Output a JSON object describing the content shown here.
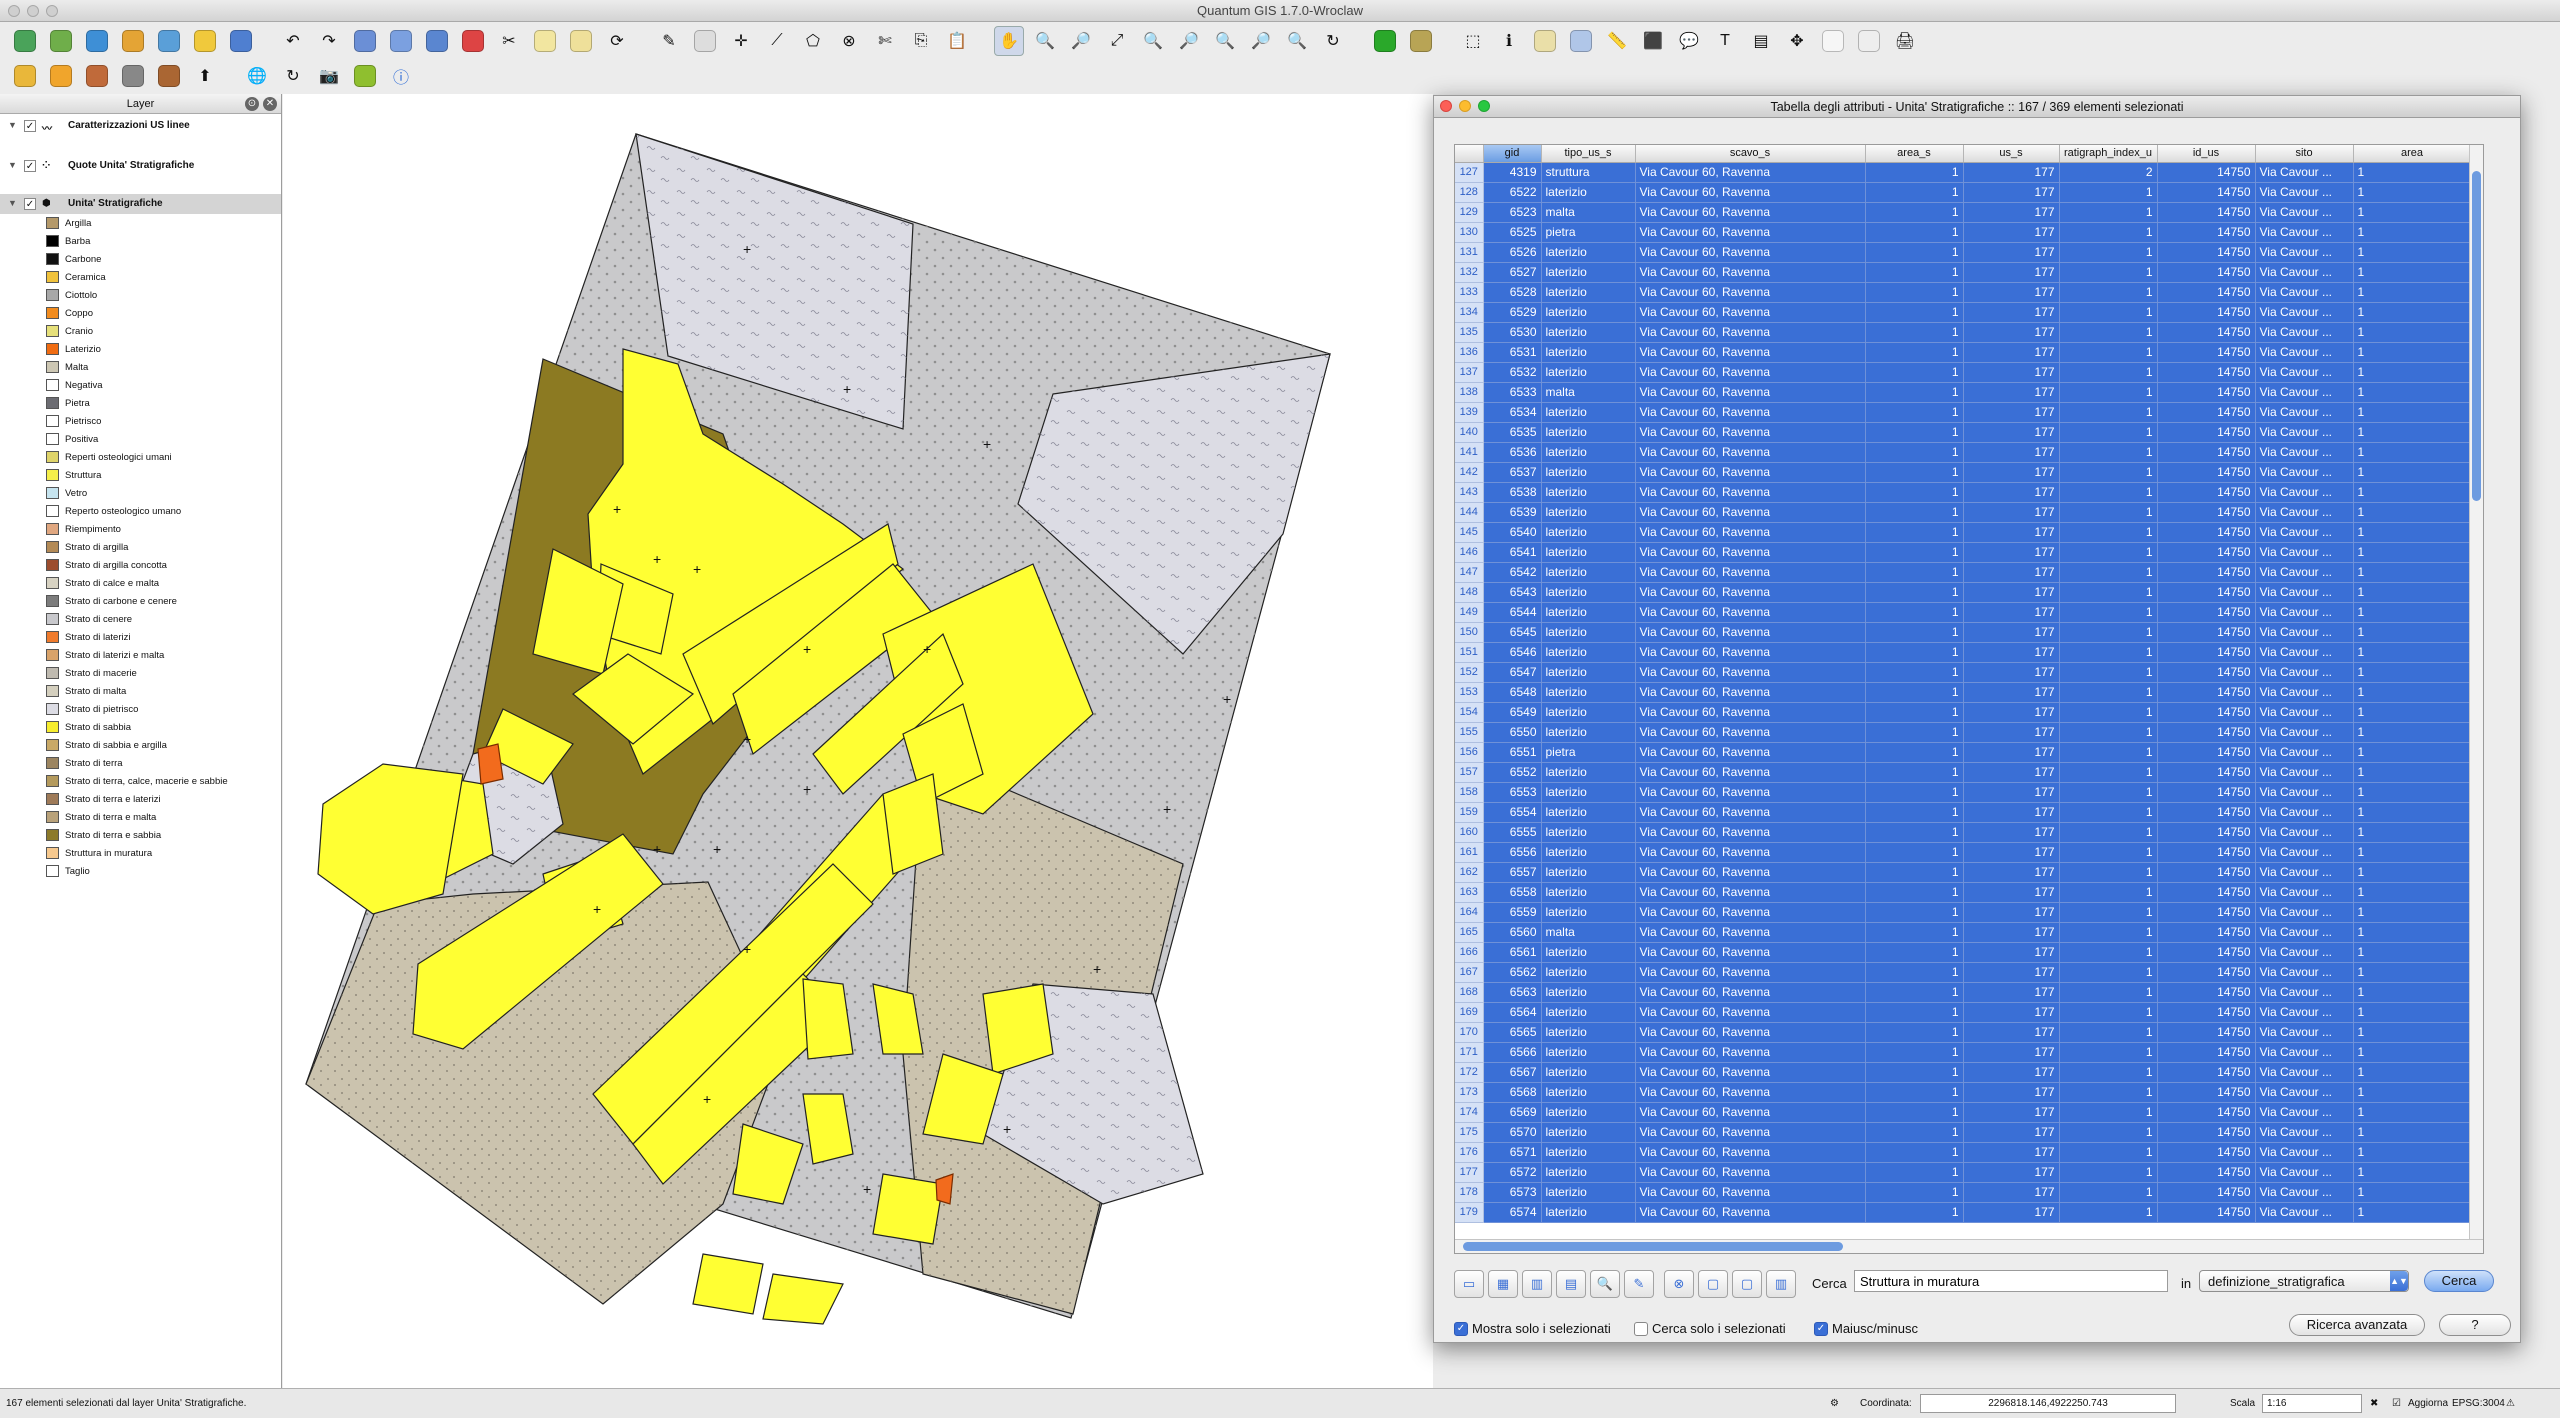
{
  "app": {
    "title": "Quantum GIS 1.7.0-Wroclaw"
  },
  "layer_panel": {
    "title": "Layer",
    "layers": [
      {
        "name": "Caratterizzazioni US linee",
        "checked": true
      },
      {
        "name": "Quote Unita' Stratigrafiche",
        "checked": true
      },
      {
        "name": "Unita' Stratigrafiche",
        "checked": true
      }
    ],
    "legend": [
      {
        "label": "Argilla",
        "color": "#b4996a"
      },
      {
        "label": "Barba",
        "color": "#000000"
      },
      {
        "label": "Carbone",
        "color": "#111111"
      },
      {
        "label": "Ceramica",
        "color": "#f0c23c"
      },
      {
        "label": "Ciottolo",
        "color": "#a8a8a8"
      },
      {
        "label": "Coppo",
        "color": "#f28c1e"
      },
      {
        "label": "Cranio",
        "color": "#e6e07a"
      },
      {
        "label": "Laterizio",
        "color": "#f06c12"
      },
      {
        "label": "Malta",
        "color": "#cdc7b3"
      },
      {
        "label": "Negativa",
        "color": "#ffffff"
      },
      {
        "label": "Pietra",
        "color": "#6c6c72"
      },
      {
        "label": "Pietrisco",
        "color": "#ffffff"
      },
      {
        "label": "Positiva",
        "color": "#ffffff"
      },
      {
        "label": "Reperti osteologici umani",
        "color": "#dfd46a"
      },
      {
        "label": "Struttura",
        "color": "#f5ef4a"
      },
      {
        "label": "Vetro",
        "color": "#c6e4ef"
      },
      {
        "label": "Reperto osteologico umano",
        "color": "#ffffff"
      },
      {
        "label": "Riempimento",
        "color": "#e0a780"
      },
      {
        "label": "Strato di argilla",
        "color": "#b38a56"
      },
      {
        "label": "Strato di argilla concotta",
        "color": "#9c4d2e"
      },
      {
        "label": "Strato di calce e malta",
        "color": "#d7d2c2"
      },
      {
        "label": "Strato di carbone e cenere",
        "color": "#7c7c7c"
      },
      {
        "label": "Strato di cenere",
        "color": "#c8c8cc"
      },
      {
        "label": "Strato di laterizi",
        "color": "#ef7b2d"
      },
      {
        "label": "Strato di laterizi e malta",
        "color": "#d9a36a"
      },
      {
        "label": "Strato di macerie",
        "color": "#bfbab0"
      },
      {
        "label": "Strato di malta",
        "color": "#d4cfbe"
      },
      {
        "label": "Strato di pietrisco",
        "color": "#dcdce4"
      },
      {
        "label": "Strato di sabbia",
        "color": "#f6ed2f"
      },
      {
        "label": "Strato di sabbia e argilla",
        "color": "#c9a967"
      },
      {
        "label": "Strato di terra",
        "color": "#9c8560"
      },
      {
        "label": "Strato di terra, calce, macerie e sabbie",
        "color": "#b49a5d"
      },
      {
        "label": "Strato di terra e laterizi",
        "color": "#9e7a58"
      },
      {
        "label": "Strato di terra e malta",
        "color": "#b9a27a"
      },
      {
        "label": "Strato di terra e sabbia",
        "color": "#8c7a2a"
      },
      {
        "label": "Struttura in muratura",
        "color": "#f7c98e"
      },
      {
        "label": "Taglio",
        "color": "#ffffff"
      }
    ]
  },
  "map": {
    "colors": {
      "frame": "#dcdce4",
      "gravel": "#c9c9cb",
      "soil": "#cbc3ae",
      "olive": "#8c7a22",
      "yellow": "#ffff33",
      "orange": "#f26b1d",
      "white": "#ffffff"
    }
  },
  "attr_window": {
    "title": "Tabella degli attributi - Unita' Stratigrafiche :: 167 / 369 elementi selezionati",
    "columns": [
      "gid",
      "tipo_us_s",
      "scavo_s",
      "area_s",
      "us_s",
      "ratigraph_index_u",
      "id_us",
      "sito",
      "area"
    ],
    "row_numbers": [
      127,
      128,
      129,
      130,
      131,
      132,
      133,
      134,
      135,
      136,
      137,
      138,
      139,
      140,
      141,
      142,
      143,
      144,
      145,
      146,
      147,
      148,
      149,
      150,
      151,
      152,
      153,
      154,
      155,
      156,
      157,
      158,
      159,
      160,
      161,
      162,
      163,
      164,
      165,
      166,
      167,
      168,
      169,
      170,
      171,
      172,
      173,
      174,
      175,
      176,
      177,
      178,
      179
    ],
    "gid": [
      4319,
      6522,
      6523,
      6525,
      6526,
      6527,
      6528,
      6529,
      6530,
      6531,
      6532,
      6533,
      6534,
      6535,
      6536,
      6537,
      6538,
      6539,
      6540,
      6541,
      6542,
      6543,
      6544,
      6545,
      6546,
      6547,
      6548,
      6549,
      6550,
      6551,
      6552,
      6553,
      6554,
      6555,
      6556,
      6557,
      6558,
      6559,
      6560,
      6561,
      6562,
      6563,
      6564,
      6565,
      6566,
      6567,
      6568,
      6569,
      6570,
      6571,
      6572,
      6573,
      6574
    ],
    "tipo_overrides": {
      "0": "struttura",
      "2": "malta",
      "3": "pietra",
      "11": "malta",
      "29": "pietra",
      "38": "malta"
    },
    "tipo_default": "laterizio",
    "scavo": "Via Cavour 60, Ravenna",
    "area_s": "1",
    "us_s": "177",
    "strat_default": "1",
    "strat_first": "2",
    "id_us": "14750",
    "sito": "Via Cavour ...",
    "area": "1",
    "search_label": "Cerca",
    "search_value": "Struttura in muratura",
    "in_label": "in",
    "field": "definizione_stratigrafica",
    "search_button": "Cerca",
    "show_selected": "Mostra solo i selezionati",
    "search_selected": "Cerca solo i selezionati",
    "case": "Maiusc/minusc",
    "advanced": "Ricerca avanzata",
    "help": "?"
  },
  "status": {
    "message": "167 elementi selezionati dal layer Unita' Stratigrafiche.",
    "coord_label": "Coordinata:",
    "coord_value": "2296818.146,4922250.743",
    "scale_label": "Scala",
    "scale_value": "1:16",
    "render_label": "Aggiorna",
    "crs": "EPSG:3004"
  }
}
